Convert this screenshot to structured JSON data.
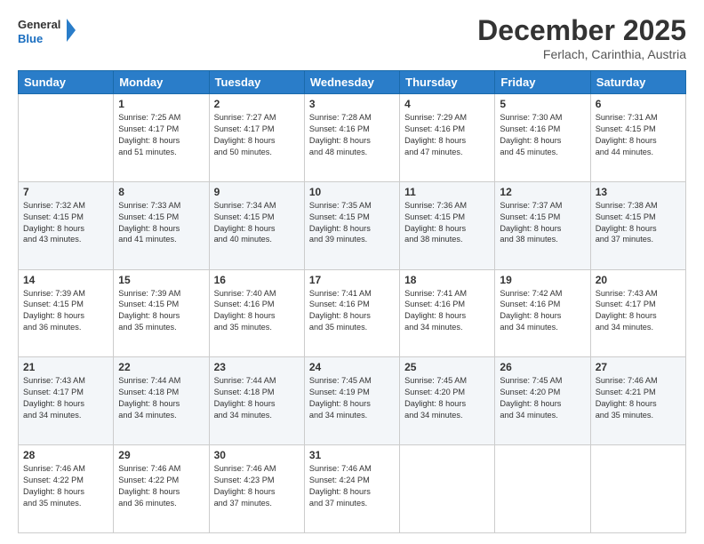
{
  "header": {
    "logo_line1": "General",
    "logo_line2": "Blue",
    "month": "December 2025",
    "location": "Ferlach, Carinthia, Austria"
  },
  "weekdays": [
    "Sunday",
    "Monday",
    "Tuesday",
    "Wednesday",
    "Thursday",
    "Friday",
    "Saturday"
  ],
  "weeks": [
    [
      {
        "day": "",
        "info": ""
      },
      {
        "day": "1",
        "info": "Sunrise: 7:25 AM\nSunset: 4:17 PM\nDaylight: 8 hours\nand 51 minutes."
      },
      {
        "day": "2",
        "info": "Sunrise: 7:27 AM\nSunset: 4:17 PM\nDaylight: 8 hours\nand 50 minutes."
      },
      {
        "day": "3",
        "info": "Sunrise: 7:28 AM\nSunset: 4:16 PM\nDaylight: 8 hours\nand 48 minutes."
      },
      {
        "day": "4",
        "info": "Sunrise: 7:29 AM\nSunset: 4:16 PM\nDaylight: 8 hours\nand 47 minutes."
      },
      {
        "day": "5",
        "info": "Sunrise: 7:30 AM\nSunset: 4:16 PM\nDaylight: 8 hours\nand 45 minutes."
      },
      {
        "day": "6",
        "info": "Sunrise: 7:31 AM\nSunset: 4:15 PM\nDaylight: 8 hours\nand 44 minutes."
      }
    ],
    [
      {
        "day": "7",
        "info": "Sunrise: 7:32 AM\nSunset: 4:15 PM\nDaylight: 8 hours\nand 43 minutes."
      },
      {
        "day": "8",
        "info": "Sunrise: 7:33 AM\nSunset: 4:15 PM\nDaylight: 8 hours\nand 41 minutes."
      },
      {
        "day": "9",
        "info": "Sunrise: 7:34 AM\nSunset: 4:15 PM\nDaylight: 8 hours\nand 40 minutes."
      },
      {
        "day": "10",
        "info": "Sunrise: 7:35 AM\nSunset: 4:15 PM\nDaylight: 8 hours\nand 39 minutes."
      },
      {
        "day": "11",
        "info": "Sunrise: 7:36 AM\nSunset: 4:15 PM\nDaylight: 8 hours\nand 38 minutes."
      },
      {
        "day": "12",
        "info": "Sunrise: 7:37 AM\nSunset: 4:15 PM\nDaylight: 8 hours\nand 38 minutes."
      },
      {
        "day": "13",
        "info": "Sunrise: 7:38 AM\nSunset: 4:15 PM\nDaylight: 8 hours\nand 37 minutes."
      }
    ],
    [
      {
        "day": "14",
        "info": "Sunrise: 7:39 AM\nSunset: 4:15 PM\nDaylight: 8 hours\nand 36 minutes."
      },
      {
        "day": "15",
        "info": "Sunrise: 7:39 AM\nSunset: 4:15 PM\nDaylight: 8 hours\nand 35 minutes."
      },
      {
        "day": "16",
        "info": "Sunrise: 7:40 AM\nSunset: 4:16 PM\nDaylight: 8 hours\nand 35 minutes."
      },
      {
        "day": "17",
        "info": "Sunrise: 7:41 AM\nSunset: 4:16 PM\nDaylight: 8 hours\nand 35 minutes."
      },
      {
        "day": "18",
        "info": "Sunrise: 7:41 AM\nSunset: 4:16 PM\nDaylight: 8 hours\nand 34 minutes."
      },
      {
        "day": "19",
        "info": "Sunrise: 7:42 AM\nSunset: 4:16 PM\nDaylight: 8 hours\nand 34 minutes."
      },
      {
        "day": "20",
        "info": "Sunrise: 7:43 AM\nSunset: 4:17 PM\nDaylight: 8 hours\nand 34 minutes."
      }
    ],
    [
      {
        "day": "21",
        "info": "Sunrise: 7:43 AM\nSunset: 4:17 PM\nDaylight: 8 hours\nand 34 minutes."
      },
      {
        "day": "22",
        "info": "Sunrise: 7:44 AM\nSunset: 4:18 PM\nDaylight: 8 hours\nand 34 minutes."
      },
      {
        "day": "23",
        "info": "Sunrise: 7:44 AM\nSunset: 4:18 PM\nDaylight: 8 hours\nand 34 minutes."
      },
      {
        "day": "24",
        "info": "Sunrise: 7:45 AM\nSunset: 4:19 PM\nDaylight: 8 hours\nand 34 minutes."
      },
      {
        "day": "25",
        "info": "Sunrise: 7:45 AM\nSunset: 4:20 PM\nDaylight: 8 hours\nand 34 minutes."
      },
      {
        "day": "26",
        "info": "Sunrise: 7:45 AM\nSunset: 4:20 PM\nDaylight: 8 hours\nand 34 minutes."
      },
      {
        "day": "27",
        "info": "Sunrise: 7:46 AM\nSunset: 4:21 PM\nDaylight: 8 hours\nand 35 minutes."
      }
    ],
    [
      {
        "day": "28",
        "info": "Sunrise: 7:46 AM\nSunset: 4:22 PM\nDaylight: 8 hours\nand 35 minutes."
      },
      {
        "day": "29",
        "info": "Sunrise: 7:46 AM\nSunset: 4:22 PM\nDaylight: 8 hours\nand 36 minutes."
      },
      {
        "day": "30",
        "info": "Sunrise: 7:46 AM\nSunset: 4:23 PM\nDaylight: 8 hours\nand 37 minutes."
      },
      {
        "day": "31",
        "info": "Sunrise: 7:46 AM\nSunset: 4:24 PM\nDaylight: 8 hours\nand 37 minutes."
      },
      {
        "day": "",
        "info": ""
      },
      {
        "day": "",
        "info": ""
      },
      {
        "day": "",
        "info": ""
      }
    ]
  ]
}
